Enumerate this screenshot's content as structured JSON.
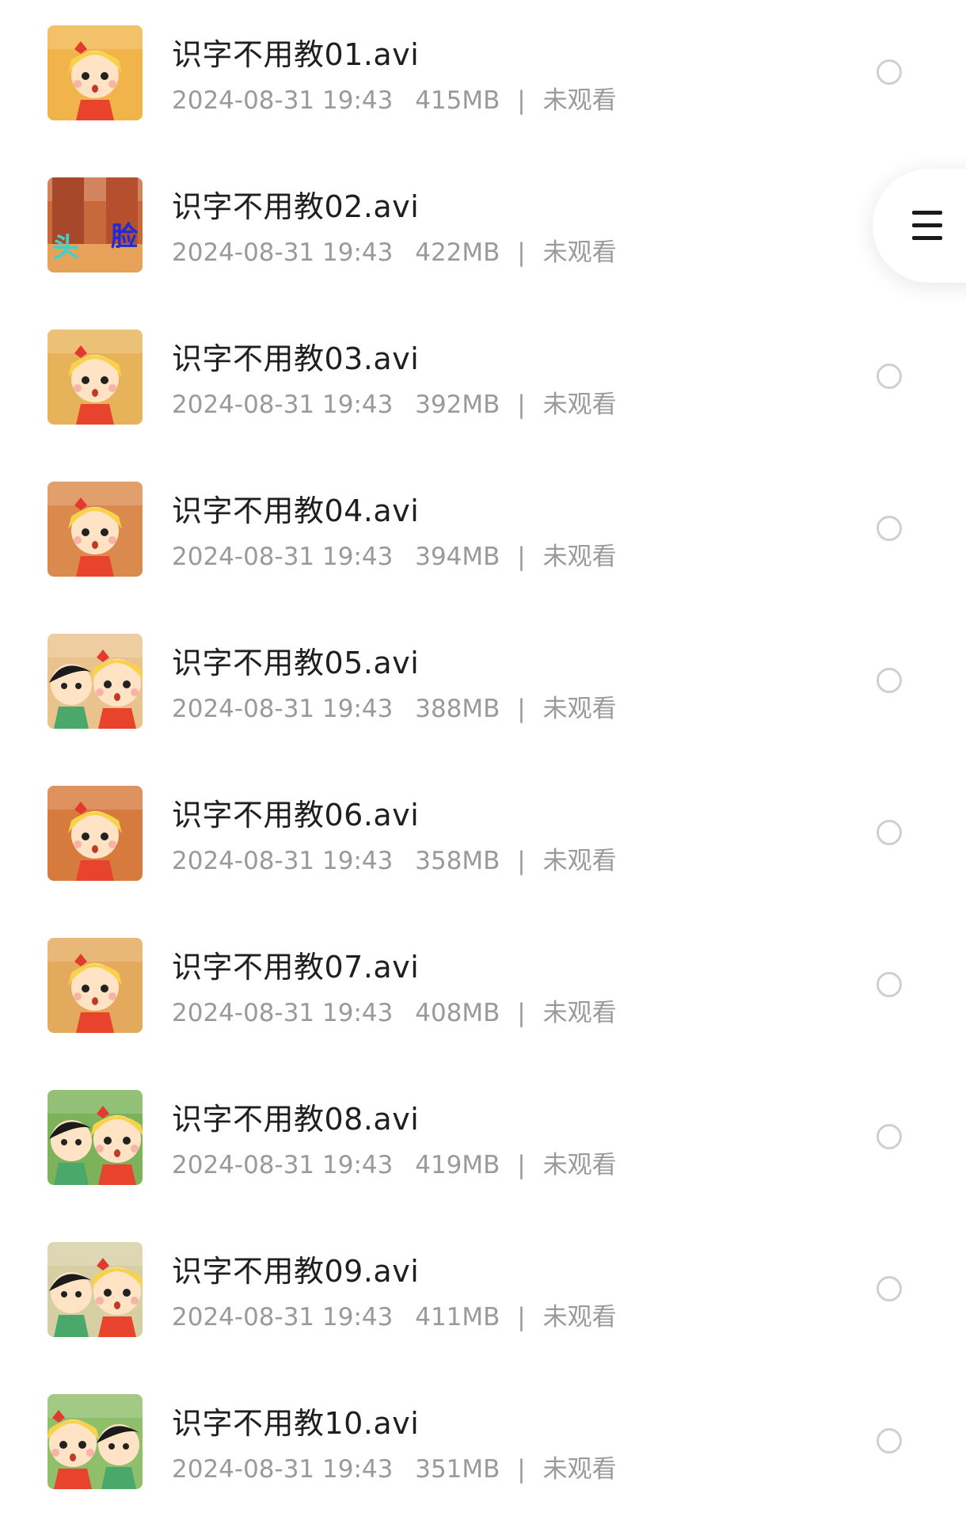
{
  "videos": [
    {
      "title": "识字不用教01.avi",
      "date": "2024-08-31 19:43",
      "size": "415MB",
      "status": "未观看",
      "thumb_bg": "#f0b44a",
      "thumb_char": "girl"
    },
    {
      "title": "识字不用教02.avi",
      "date": "2024-08-31 19:43",
      "size": "422MB",
      "status": "未观看",
      "thumb_bg": "#c8693c",
      "thumb_char": "text",
      "thumb_text_left": "头",
      "thumb_text_right": "脸"
    },
    {
      "title": "识字不用教03.avi",
      "date": "2024-08-31 19:43",
      "size": "392MB",
      "status": "未观看",
      "thumb_bg": "#e7b35a",
      "thumb_char": "girl"
    },
    {
      "title": "识字不用教04.avi",
      "date": "2024-08-31 19:43",
      "size": "394MB",
      "status": "未观看",
      "thumb_bg": "#d98a4c",
      "thumb_char": "girl"
    },
    {
      "title": "识字不用教05.avi",
      "date": "2024-08-31 19:43",
      "size": "388MB",
      "status": "未观看",
      "thumb_bg": "#e9c28d",
      "thumb_char": "boy-girl"
    },
    {
      "title": "识字不用教06.avi",
      "date": "2024-08-31 19:43",
      "size": "358MB",
      "status": "未观看",
      "thumb_bg": "#d77a3e",
      "thumb_char": "girl"
    },
    {
      "title": "识字不用教07.avi",
      "date": "2024-08-31 19:43",
      "size": "408MB",
      "status": "未观看",
      "thumb_bg": "#e3a95c",
      "thumb_char": "girl"
    },
    {
      "title": "识字不用教08.avi",
      "date": "2024-08-31 19:43",
      "size": "419MB",
      "status": "未观看",
      "thumb_bg": "#7cb35a",
      "thumb_char": "boy-girl"
    },
    {
      "title": "识字不用教09.avi",
      "date": "2024-08-31 19:43",
      "size": "411MB",
      "status": "未观看",
      "thumb_bg": "#d6cfa3",
      "thumb_char": "boy-girl"
    },
    {
      "title": "识字不用教10.avi",
      "date": "2024-08-31 19:43",
      "size": "351MB",
      "status": "未观看",
      "thumb_bg": "#8fbf6a",
      "thumb_char": "girl-boy"
    }
  ],
  "menu_button": {
    "icon": "menu-icon"
  },
  "colors": {
    "title": "#1f1f1f",
    "meta": "#9a9a9a",
    "radio_border": "#cfcfcf",
    "background": "#ffffff"
  }
}
